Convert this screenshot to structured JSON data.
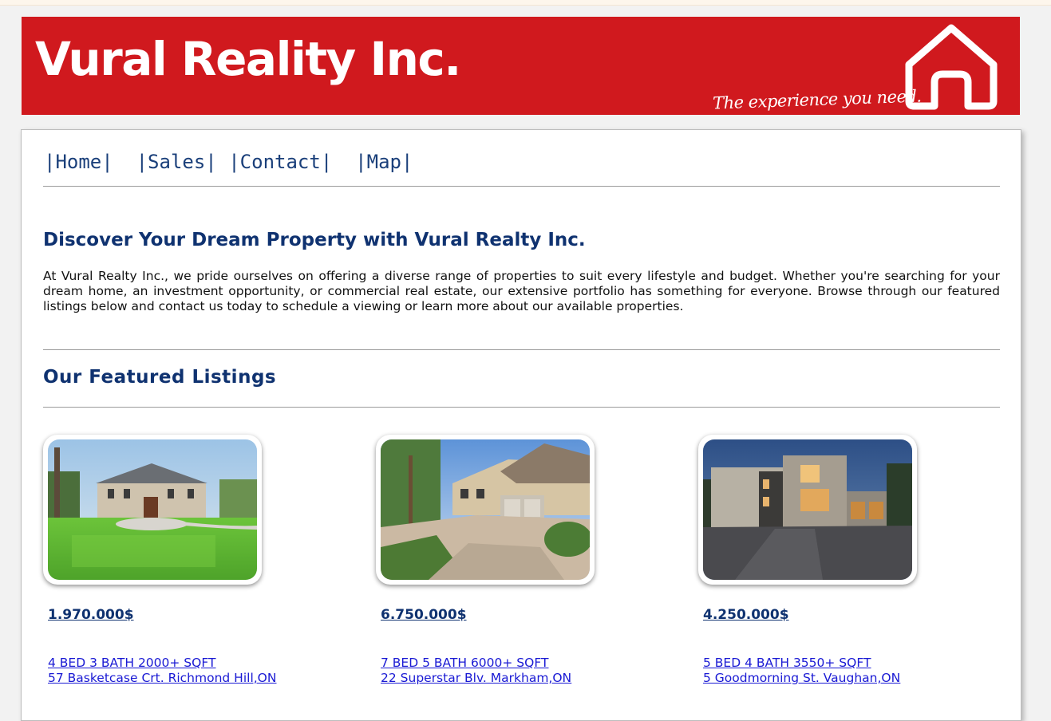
{
  "banner": {
    "title": "Vural Reality Inc.",
    "tagline": "The experience you need.",
    "logo_icon": "house-outline-icon",
    "background_color": "#d0191e"
  },
  "nav": {
    "items": [
      {
        "label": "|Home|"
      },
      {
        "label": "|Sales|"
      },
      {
        "label": "|Contact|"
      },
      {
        "label": "|Map|"
      }
    ]
  },
  "main": {
    "heading": "Discover Your Dream Property with Vural Realty Inc.",
    "intro": "At Vural Realty Inc., we pride ourselves on offering a diverse range of properties to suit every lifestyle and budget. Whether you're searching for your dream home, an investment opportunity, or commercial real estate, our extensive portfolio has something for everyone. Browse through our featured listings below and contact us today to schedule a viewing or learn more about our available properties.",
    "featured_heading": "Our Featured Listings"
  },
  "listings": [
    {
      "price": "1.970.000$",
      "specs": "4 BED  3 BATH  2000+ SQFT",
      "address": "57 Basketcase Crt. Richmond Hill,ON"
    },
    {
      "price": "6.750.000$",
      "specs": "7 BED  5 BATH  6000+ SQFT",
      "address": "22 Superstar Blv. Markham,ON"
    },
    {
      "price": "4.250.000$",
      "specs": "5 BED  4 BATH  3550+ SQFT",
      "address": "5 Goodmorning St. Vaughan,ON"
    }
  ],
  "colors": {
    "heading": "#0f3270",
    "link": "#1a1ad4",
    "nav": "#1a3f7a"
  }
}
